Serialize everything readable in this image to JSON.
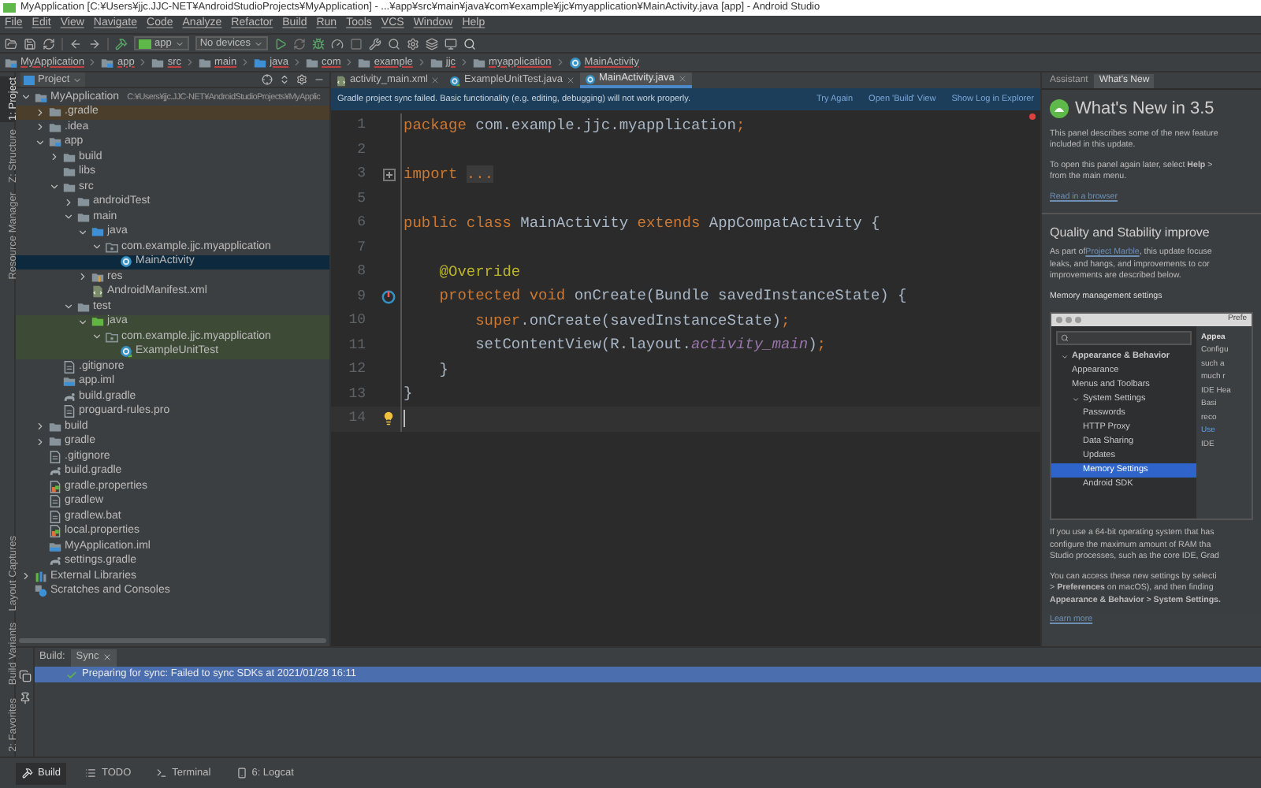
{
  "window": {
    "title": "MyApplication [C:¥Users¥jjc.JJC-NET¥AndroidStudioProjects¥MyApplication] - ...¥app¥src¥main¥java¥com¥example¥jjc¥myapplication¥MainActivity.java [app] - Android Studio"
  },
  "menu": [
    "File",
    "Edit",
    "View",
    "Navigate",
    "Code",
    "Analyze",
    "Refactor",
    "Build",
    "Run",
    "Tools",
    "VCS",
    "Window",
    "Help"
  ],
  "toolbar": {
    "run_config": "app",
    "device": "No devices"
  },
  "breadcrumbs": [
    {
      "label": "MyApplication",
      "kind": "module"
    },
    {
      "label": "app",
      "kind": "module"
    },
    {
      "label": "src",
      "kind": "folder"
    },
    {
      "label": "main",
      "kind": "folder"
    },
    {
      "label": "java",
      "kind": "source"
    },
    {
      "label": "com",
      "kind": "folder"
    },
    {
      "label": "example",
      "kind": "folder"
    },
    {
      "label": "jjc",
      "kind": "folder"
    },
    {
      "label": "myapplication",
      "kind": "folder"
    },
    {
      "label": "MainActivity",
      "kind": "class"
    }
  ],
  "side_tabs_top": [
    {
      "label": "1: Project",
      "selected": true
    },
    {
      "label": "Z: Structure",
      "selected": false
    },
    {
      "label": "Resource Manager",
      "selected": false
    }
  ],
  "side_tabs_bottom": [
    {
      "label": "Layout Captures",
      "selected": false
    },
    {
      "label": "Build Variants",
      "selected": false
    },
    {
      "label": "2: Favorites",
      "selected": false
    }
  ],
  "project": {
    "view": "Project",
    "tree": [
      {
        "name": "MyApplication",
        "path": "C:¥Users¥jjc.JJC-NET¥AndroidStudioProjects¥MyApplic",
        "kind": "module",
        "expanded": true,
        "selected": false,
        "children": [
          {
            "name": ".gradle",
            "kind": "folder",
            "excluded": true,
            "expanded": false,
            "selected": false
          },
          {
            "name": ".idea",
            "kind": "folder",
            "expanded": false,
            "selected": false
          },
          {
            "name": "app",
            "kind": "module",
            "expanded": true,
            "selected": false,
            "children": [
              {
                "name": "build",
                "kind": "folder",
                "expanded": false,
                "selected": false
              },
              {
                "name": "libs",
                "kind": "folder",
                "selected": false
              },
              {
                "name": "src",
                "kind": "folder",
                "expanded": true,
                "selected": false,
                "children": [
                  {
                    "name": "androidTest",
                    "kind": "folder",
                    "expanded": false,
                    "selected": false
                  },
                  {
                    "name": "main",
                    "kind": "folder",
                    "expanded": true,
                    "selected": false,
                    "children": [
                      {
                        "name": "java",
                        "kind": "source",
                        "expanded": true,
                        "selected": false,
                        "children": [
                          {
                            "name": "com.example.jjc.myapplication",
                            "kind": "package",
                            "expanded": true,
                            "selected": false,
                            "children": [
                              {
                                "name": "MainActivity",
                                "kind": "class",
                                "selected": true
                              }
                            ]
                          }
                        ]
                      },
                      {
                        "name": "res",
                        "kind": "resources",
                        "expanded": false,
                        "selected": false
                      },
                      {
                        "name": "AndroidManifest.xml",
                        "kind": "manifest",
                        "selected": false
                      }
                    ]
                  },
                  {
                    "name": "test",
                    "kind": "folder",
                    "expanded": true,
                    "selected": false,
                    "children": [
                      {
                        "name": "java",
                        "kind": "test",
                        "test_source": true,
                        "expanded": true,
                        "selected": false,
                        "children": [
                          {
                            "name": "com.example.jjc.myapplication",
                            "kind": "package",
                            "test_source": true,
                            "expanded": true,
                            "selected": false,
                            "children": [
                              {
                                "name": "ExampleUnitTest",
                                "kind": "test-class",
                                "test_source": true,
                                "selected": false
                              }
                            ]
                          }
                        ]
                      }
                    ]
                  }
                ]
              },
              {
                "name": ".gitignore",
                "kind": "file",
                "selected": false
              },
              {
                "name": "app.iml",
                "kind": "iml",
                "selected": false
              },
              {
                "name": "build.gradle",
                "kind": "gradle",
                "selected": false
              },
              {
                "name": "proguard-rules.pro",
                "kind": "file",
                "selected": false
              }
            ]
          },
          {
            "name": "build",
            "kind": "folder",
            "expanded": false,
            "selected": false
          },
          {
            "name": "gradle",
            "kind": "folder",
            "expanded": false,
            "selected": false
          },
          {
            "name": ".gitignore",
            "kind": "file",
            "selected": false
          },
          {
            "name": "build.gradle",
            "kind": "gradle",
            "selected": false
          },
          {
            "name": "gradle.properties",
            "kind": "properties",
            "selected": false
          },
          {
            "name": "gradlew",
            "kind": "file",
            "selected": false
          },
          {
            "name": "gradlew.bat",
            "kind": "file",
            "selected": false
          },
          {
            "name": "local.properties",
            "kind": "properties",
            "selected": false
          },
          {
            "name": "MyApplication.iml",
            "kind": "iml",
            "selected": false
          },
          {
            "name": "settings.gradle",
            "kind": "gradle",
            "selected": false
          }
        ]
      },
      {
        "name": "External Libraries",
        "kind": "library",
        "expanded": false,
        "selected": false
      },
      {
        "name": "Scratches and Consoles",
        "kind": "scratches",
        "selected": false
      }
    ]
  },
  "editor": {
    "tabs": [
      {
        "label": "activity_main.xml",
        "kind": "xml",
        "selected": false
      },
      {
        "label": "ExampleUnitTest.java",
        "kind": "test-class",
        "selected": false
      },
      {
        "label": "MainActivity.java",
        "kind": "class",
        "selected": true
      }
    ],
    "banner": {
      "message": "Gradle project sync failed. Basic functionality (e.g. editing, debugging) will not work properly.",
      "links": [
        "Try Again",
        "Open 'Build' View",
        "Show Log in Explorer"
      ]
    },
    "lines": [
      {
        "number": "1",
        "kind": "plain",
        "current": false,
        "tokens": [
          {
            "t": "package",
            "kind": "keyword"
          },
          {
            "t": " com.example.jjc.myapplication",
            "kind": "plain"
          },
          {
            "t": ";",
            "kind": "keyword"
          }
        ]
      },
      {
        "number": "2",
        "kind": "plain",
        "current": false
      },
      {
        "number": "3",
        "kind": "fold",
        "current": false,
        "tokens": [
          {
            "t": "import ",
            "kind": "keyword"
          },
          {
            "t": "...",
            "kind": "folded"
          }
        ]
      },
      {
        "number": "5",
        "kind": "plain",
        "current": false
      },
      {
        "number": "6",
        "kind": "plain",
        "current": false,
        "tokens": [
          {
            "t": "public class",
            "kind": "keyword"
          },
          {
            "t": " MainActivity ",
            "kind": "plain"
          },
          {
            "t": "extends",
            "kind": "keyword"
          },
          {
            "t": " AppCompatActivity {",
            "kind": "plain"
          }
        ]
      },
      {
        "number": "7",
        "kind": "plain",
        "current": false
      },
      {
        "number": "8",
        "kind": "plain",
        "current": false,
        "tokens": [
          {
            "t": "    @Override",
            "kind": "annotation"
          }
        ]
      },
      {
        "number": "9",
        "kind": "override",
        "current": false,
        "tokens": [
          {
            "t": "    protected void",
            "kind": "keyword"
          },
          {
            "t": " onCreate(Bundle savedInstanceState) {",
            "kind": "plain"
          }
        ]
      },
      {
        "number": "10",
        "kind": "plain",
        "current": false,
        "tokens": [
          {
            "t": "        super",
            "kind": "keyword"
          },
          {
            "t": ".onCreate(savedInstanceState)",
            "kind": "plain"
          },
          {
            "t": ";",
            "kind": "keyword"
          }
        ]
      },
      {
        "number": "11",
        "kind": "plain",
        "current": false,
        "tokens": [
          {
            "t": "        setContentView(R.layout.",
            "kind": "plain"
          },
          {
            "t": "activity_main",
            "kind": "field"
          },
          {
            "t": ")",
            "kind": "plain"
          },
          {
            "t": ";",
            "kind": "keyword"
          }
        ]
      },
      {
        "number": "12",
        "kind": "plain",
        "current": false,
        "tokens": [
          {
            "t": "    }",
            "kind": "plain"
          }
        ]
      },
      {
        "number": "13",
        "kind": "plain",
        "current": false,
        "tokens": [
          {
            "t": "}",
            "kind": "plain"
          }
        ]
      },
      {
        "number": "14",
        "kind": "bulb",
        "current": true
      }
    ]
  },
  "assistant": {
    "tabs": [
      {
        "label": "Assistant",
        "selected": false
      },
      {
        "label": "What's New",
        "selected": true
      }
    ],
    "heading": "What's New in 3.5",
    "intro": [
      [
        [
          {
            "t": "This panel describes some of the new feature"
          }
        ],
        [
          {
            "t": "included in this update."
          }
        ]
      ],
      [
        [
          {
            "t": "To open this panel again later, select **Help** >"
          }
        ],
        [
          {
            "t": "from the main menu."
          }
        ]
      ],
      [
        [
          {
            "t": "Read in a browser",
            "link": true
          }
        ]
      ]
    ],
    "section": "Quality and Stability improve",
    "body": [
      [
        [
          {
            "t": "As part of "
          },
          {
            "t": "Project Marble",
            "link": true
          },
          {
            "t": ", this update focuse"
          }
        ],
        [
          {
            "t": "leaks, and hangs, and improvements to cor"
          }
        ],
        [
          {
            "t": "improvements are described below."
          }
        ]
      ],
      [
        [
          {
            "t": "Memory management settings"
          }
        ]
      ]
    ],
    "inset": {
      "title": "Prefe",
      "items": [
        {
          "label": "Appearance & Behavior",
          "expanded": true,
          "selected": false,
          "children": [
            {
              "label": "Appearance",
              "selected": false
            },
            {
              "label": "Menus and Toolbars",
              "selected": false
            },
            {
              "label": "System Settings",
              "expanded": true,
              "selected": false,
              "children": [
                {
                  "label": "Passwords",
                  "selected": false
                },
                {
                  "label": "HTTP Proxy",
                  "selected": false
                },
                {
                  "label": "Data Sharing",
                  "selected": false
                },
                {
                  "label": "Updates",
                  "selected": false
                },
                {
                  "label": "Memory Settings",
                  "selected": true
                },
                {
                  "label": "Android SDK",
                  "selected": false
                }
              ]
            }
          ]
        }
      ],
      "pane": [
        {
          "t": "Appea",
          "kind": "heading"
        },
        {
          "t": "Configu",
          "kind": "text"
        },
        {
          "t": "such a",
          "kind": "text"
        },
        {
          "t": "much r",
          "kind": "text"
        },
        {
          "t": "IDE Hea",
          "kind": "text"
        },
        {
          "t": "Basi",
          "kind": "text"
        },
        {
          "t": "reco",
          "kind": "text"
        },
        {
          "t": "Use",
          "kind": "link"
        },
        {
          "t": "IDE",
          "kind": "text"
        }
      ]
    },
    "outro": [
      [
        [
          {
            "t": "If you use a 64-bit operating system that has"
          }
        ],
        [
          {
            "t": "configure the maximum amount of RAM tha"
          }
        ],
        [
          {
            "t": "Studio processes, such as the core IDE, Grad"
          }
        ]
      ],
      [
        [
          {
            "t": "You can access these new settings by selecti"
          }
        ],
        [
          {
            "t": "> **Preferences** on macOS), and then finding"
          }
        ],
        [
          {
            "t": "**Appearance & Behavior > System Settings.**"
          }
        ]
      ],
      [
        [
          {
            "t": "Learn more",
            "link": true
          }
        ]
      ]
    ]
  },
  "build_panel": {
    "tabs": [
      {
        "label": "Build:",
        "kind": "label"
      },
      {
        "label": "Sync",
        "kind": "tab",
        "selected": true
      }
    ],
    "rows": [
      {
        "text": "Preparing for sync: Failed to sync SDKs at 2021/01/28 16:11",
        "selected": true
      }
    ]
  },
  "bottom_tabs": [
    {
      "label": "Build",
      "kind": "build",
      "selected": true
    },
    {
      "label": "TODO",
      "kind": "todo",
      "selected": false
    },
    {
      "label": "Terminal",
      "kind": "terminal",
      "selected": false
    },
    {
      "label": "6: Logcat",
      "kind": "logcat",
      "selected": false
    }
  ]
}
